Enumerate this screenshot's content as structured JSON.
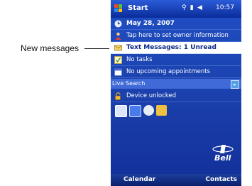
{
  "callout": {
    "label": "New messages"
  },
  "titlebar": {
    "start_label": "Start",
    "time": "10:57"
  },
  "today": {
    "date": "May 28, 2007",
    "owner": "Tap here to set owner information",
    "messages": "Text Messages: 1 Unread",
    "tasks": "No tasks",
    "appointments": "No upcoming appointments",
    "live_search_label": "Live Search",
    "device_lock": "Device unlocked"
  },
  "logo": {
    "text": "Bell"
  },
  "softkeys": {
    "left": "Calendar",
    "right": "Contacts"
  }
}
